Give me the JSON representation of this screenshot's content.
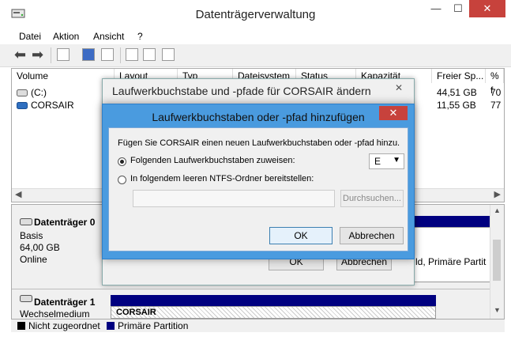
{
  "app": {
    "title": "Datenträgerverwaltung",
    "minimize": "—",
    "maximize": "☐",
    "close": "✕"
  },
  "menu": [
    "Datei",
    "Aktion",
    "Ansicht",
    "?"
  ],
  "volume_list": {
    "columns": [
      "Volume",
      "Layout",
      "Typ",
      "Dateisystem",
      "Status",
      "Kapazität",
      "Freier Sp...",
      "% f"
    ],
    "rows": [
      {
        "name": "(C:)",
        "free": "44,51 GB",
        "pct": "70"
      },
      {
        "name": "CORSAIR",
        "free": "11,55 GB",
        "pct": "77"
      }
    ]
  },
  "disks": [
    {
      "name": "Datenträger 0",
      "type": "Basis",
      "size": "64,00 GB",
      "status": "Online"
    },
    {
      "name": "Datenträger 1",
      "type": "Wechselmedium",
      "partition": "CORSAIR"
    }
  ],
  "partition_snippet": "ld, Primäre Partit",
  "legend": [
    {
      "label": "Nicht zugeordnet",
      "color": "#000000"
    },
    {
      "label": "Primäre Partition",
      "color": "#000080"
    }
  ],
  "dialog1": {
    "title": "Laufwerkbuchstabe und -pfade für CORSAIR ändern",
    "close": "✕",
    "ok": "OK",
    "cancel": "Abbrechen"
  },
  "dialog2": {
    "title": "Laufwerkbuchstaben oder -pfad hinzufügen",
    "close": "✕",
    "intro": "Fügen Sie CORSAIR einen neuen Laufwerkbuchstaben oder -pfad hinzu.",
    "option_letter": "Folgenden Laufwerkbuchstaben zuweisen:",
    "letter_value": "E",
    "option_folder": "In folgendem leeren NTFS-Ordner bereitstellen:",
    "folder_value": "",
    "browse": "Durchsuchen...",
    "ok": "OK",
    "cancel": "Abbrechen"
  },
  "colors": {
    "accent": "#4a9bdf",
    "close_red": "#c7423c",
    "partition_blue": "#000080"
  }
}
